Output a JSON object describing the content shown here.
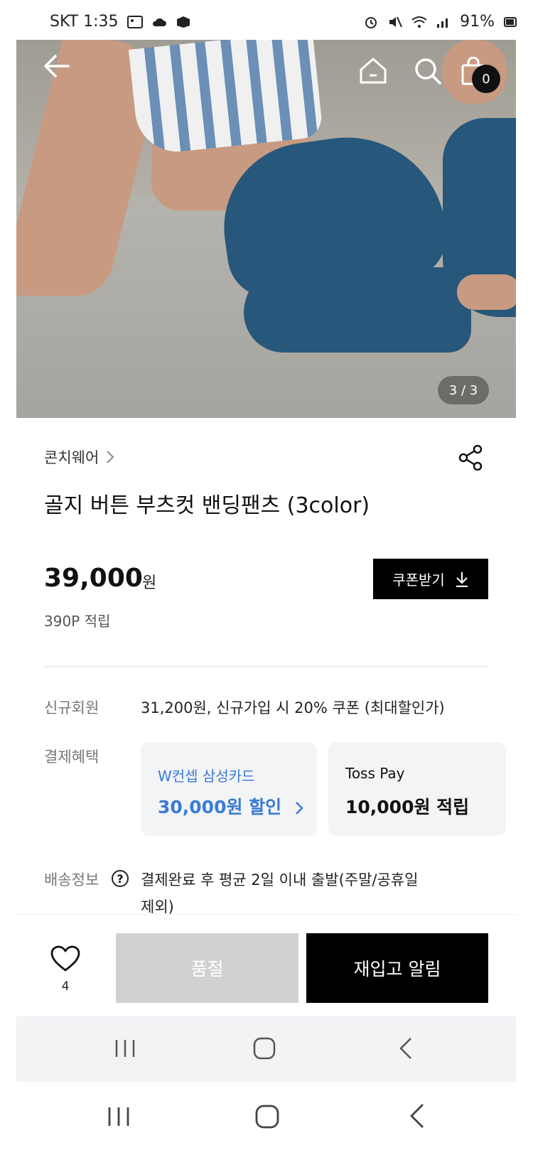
{
  "status_bar": {
    "carrier_time": "SKT 1:35",
    "battery": "91%"
  },
  "gallery": {
    "counter": "3 / 3",
    "cart_count": "0"
  },
  "product": {
    "brand": "콘치웨어",
    "title": "골지 버튼 부츠컷 밴딩팬츠 (3color)",
    "price": "39,000",
    "price_unit": "원",
    "points": "390P 적립",
    "coupon_button": "쿠폰받기"
  },
  "benefits": {
    "new_member_label": "신규회원",
    "new_member_value": "31,200원, 신규가입 시 20% 쿠폰 (최대할인가)",
    "payment_label": "결제혜택",
    "cards": [
      {
        "name": "W컨셉 삼성카드",
        "benefit": "30,000원 할인"
      },
      {
        "name": "Toss Pay",
        "benefit": "10,000원 적립"
      }
    ],
    "shipping_label": "배송정보",
    "shipping_value_line1": "결제완료 후 평균 2일 이내 출발(주말/공휴일",
    "shipping_value_line2": "제외)"
  },
  "actions": {
    "like_count": "4",
    "soldout_label": "품절",
    "restock_label": "재입고 알림"
  },
  "colors": {
    "accent_blue": "#3a7bd5",
    "primary_black": "#000000",
    "disabled_gray": "#d1d1d1"
  }
}
